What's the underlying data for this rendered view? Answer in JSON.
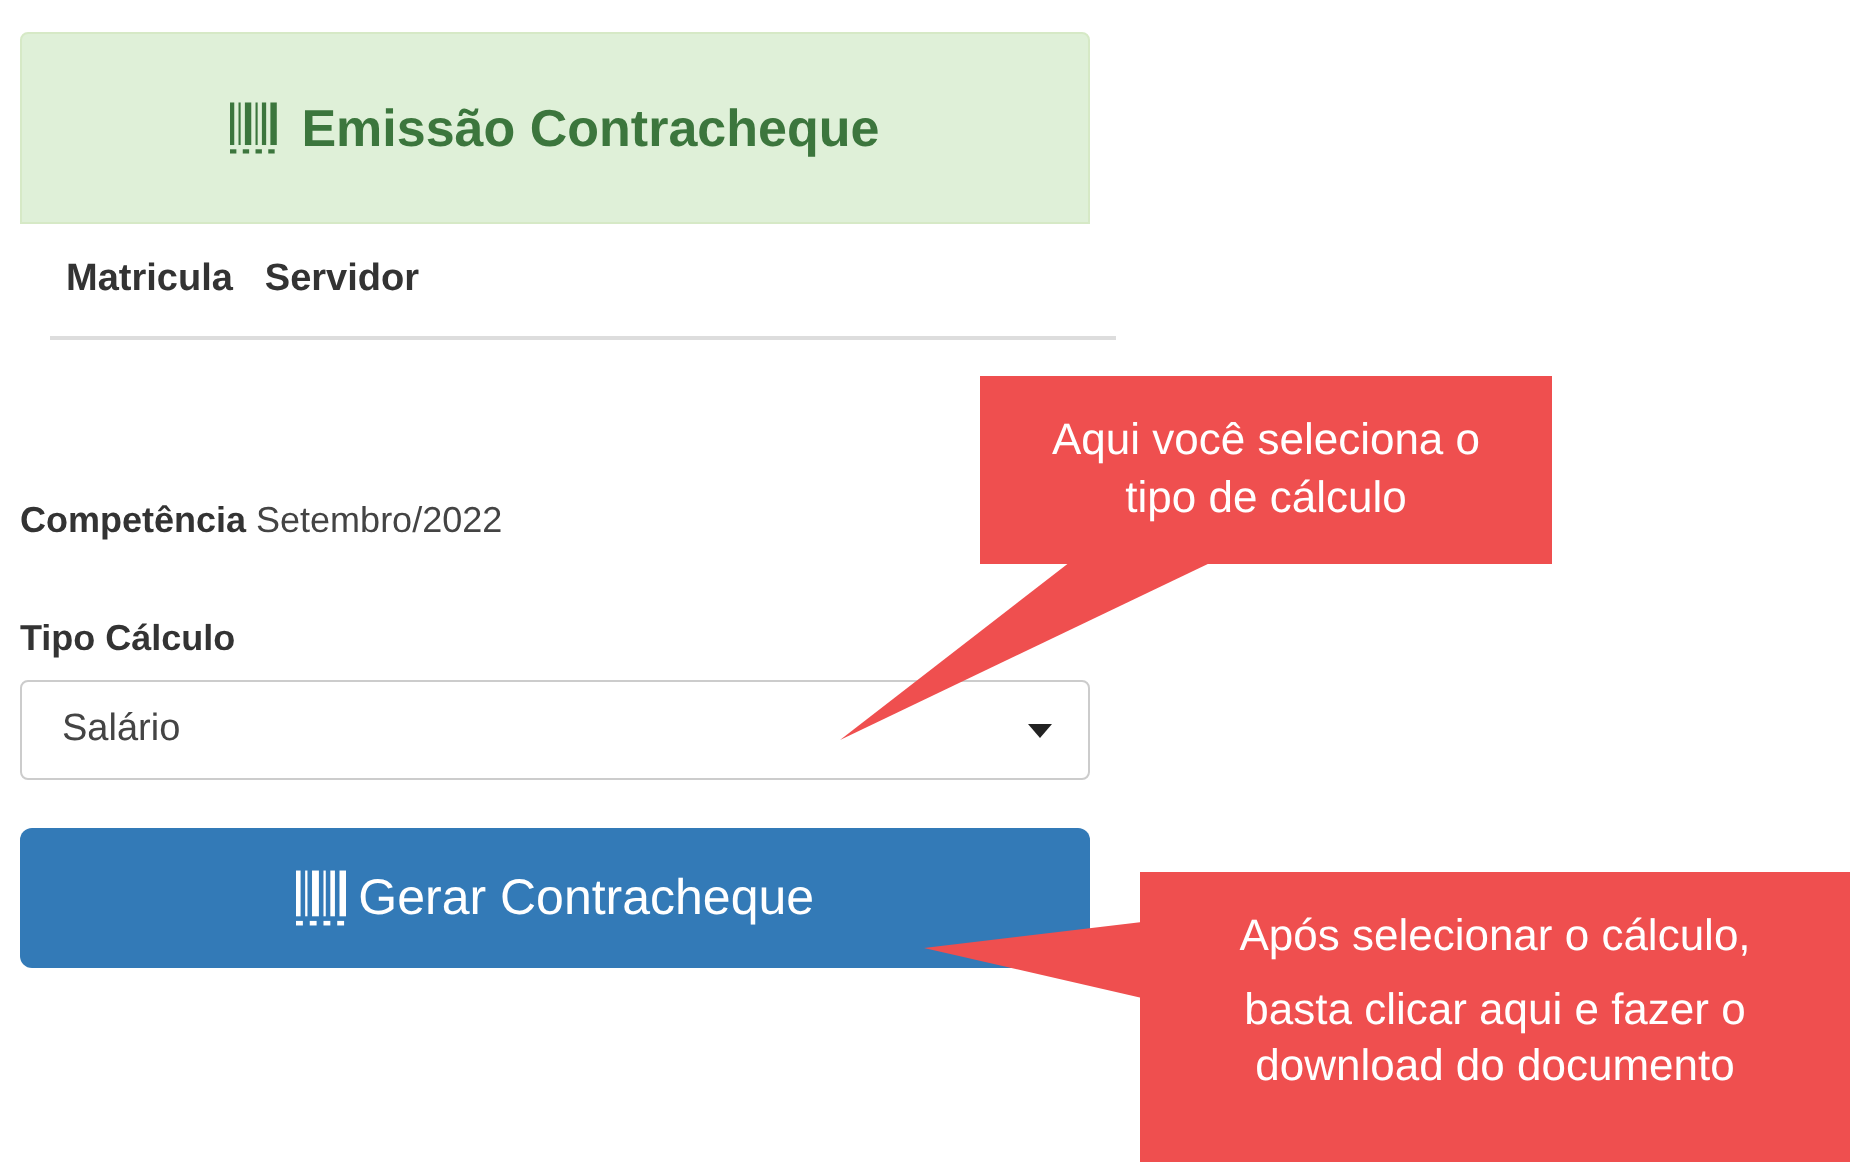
{
  "panel": {
    "title": "Emissão Contracheque"
  },
  "table": {
    "columns": [
      "Matricula",
      "Servidor"
    ]
  },
  "competencia": {
    "label": "Competência",
    "value": "Setembro/2022"
  },
  "tipo_calculo": {
    "label": "Tipo Cálculo",
    "value": "Salário"
  },
  "button": {
    "label": "Gerar Contracheque"
  },
  "callouts": [
    {
      "lines": [
        "Aqui você seleciona o",
        "tipo de cálculo"
      ]
    },
    {
      "lines": [
        "Após selecionar o cálculo,",
        "basta clicar aqui e fazer o",
        "download do documento"
      ]
    }
  ]
}
